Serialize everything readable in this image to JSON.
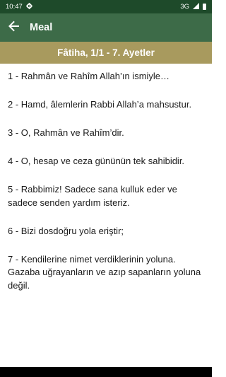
{
  "status_bar": {
    "time": "10:47",
    "network": "3G",
    "icons": [
      "settings-icon",
      "signal-icon",
      "battery-icon"
    ]
  },
  "app_bar": {
    "title": "Meal",
    "back_icon": "arrow-left-icon"
  },
  "section": {
    "title": "Fâtiha, 1/1 - 7. Ayetler"
  },
  "verses": [
    {
      "text": "1 -  Rahmân ve Rahîm Allah’ın ismiyle…"
    },
    {
      "text": "2 -  Hamd, âlemlerin Rabbi Allah’a mahsustur."
    },
    {
      "text": "3 -  O, Rahmân ve Rahîm’dir."
    },
    {
      "text": "4 -  O, hesap ve ceza gününün tek sahibidir."
    },
    {
      "text": "5 -  Rabbimiz! Sadece sana kulluk eder ve sadece senden yardım isteriz."
    },
    {
      "text": "6 -  Bizi dosdoğru yola eriştir;"
    },
    {
      "text": "7 -  Kendilerine nimet verdiklerinin yoluna. Gazaba uğrayanların ve azıp sapanların yoluna değil."
    }
  ],
  "colors": {
    "status_bar": "#1e4a2a",
    "app_bar": "#3d6b48",
    "section_header": "#a89a5e"
  }
}
